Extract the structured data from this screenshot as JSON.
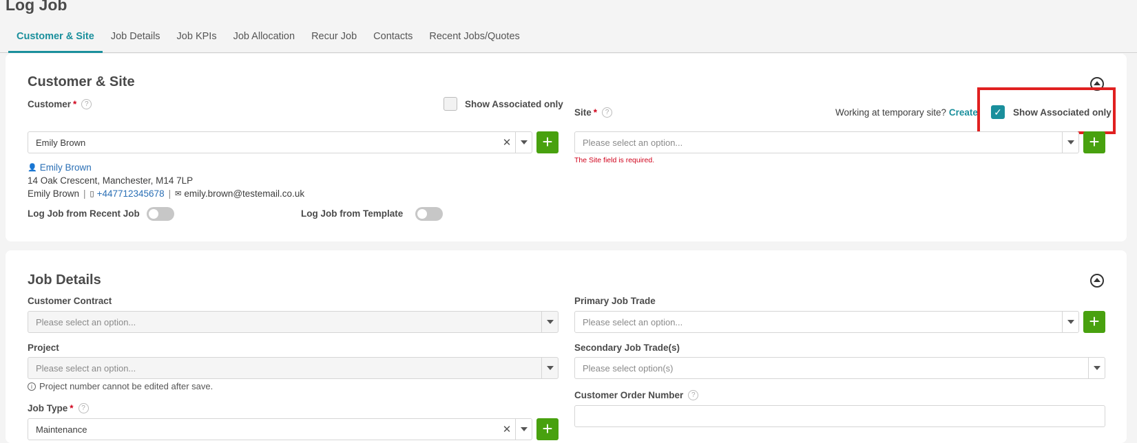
{
  "page": {
    "title": "Log Job"
  },
  "tabs": [
    {
      "label": "Customer & Site",
      "active": true
    },
    {
      "label": "Job Details"
    },
    {
      "label": "Job KPIs"
    },
    {
      "label": "Job Allocation"
    },
    {
      "label": "Recur Job"
    },
    {
      "label": "Contacts"
    },
    {
      "label": "Recent Jobs/Quotes"
    }
  ],
  "customer_site": {
    "title": "Customer & Site",
    "customer": {
      "label": "Customer",
      "required_mark": "*",
      "show_associated_label": "Show Associated only",
      "show_associated_checked": false,
      "value": "Emily Brown",
      "contact_name": "Emily Brown",
      "address": "14 Oak Crescent, Manchester, M14 7LP",
      "contact_person": "Emily Brown",
      "phone": "+447712345678",
      "email": "emily.brown@testemail.co.uk"
    },
    "site": {
      "label": "Site",
      "required_mark": "*",
      "temp_site_text": "Working at temporary site?",
      "temp_site_link": "Create",
      "show_associated_label": "Show Associated only",
      "show_associated_checked": true,
      "placeholder": "Please select an option...",
      "error": "The Site field is required."
    },
    "log_from_recent_label": "Log Job from Recent Job",
    "log_from_template_label": "Log Job from Template"
  },
  "job_details": {
    "title": "Job Details",
    "customer_contract": {
      "label": "Customer Contract",
      "placeholder": "Please select an option..."
    },
    "project": {
      "label": "Project",
      "placeholder": "Please select an option...",
      "hint": "Project number cannot be edited after save."
    },
    "job_type": {
      "label": "Job Type",
      "required_mark": "*",
      "value": "Maintenance"
    },
    "primary_job_trade": {
      "label": "Primary Job Trade",
      "placeholder": "Please select an option..."
    },
    "secondary_job_trades": {
      "label": "Secondary Job Trade(s)",
      "placeholder": "Please select option(s)"
    },
    "customer_order_number": {
      "label": "Customer Order Number"
    }
  },
  "colors": {
    "accent": "#1a8f9c",
    "add_button": "#48a10f",
    "error": "#d0021b",
    "highlight": "#e02020"
  }
}
